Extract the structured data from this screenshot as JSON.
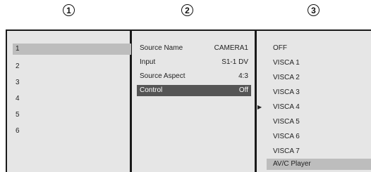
{
  "callouts": [
    "1",
    "2",
    "3"
  ],
  "column1": {
    "items": [
      "1",
      "2",
      "3",
      "4",
      "5",
      "6"
    ],
    "selected_index": 0
  },
  "column2": {
    "rows": [
      {
        "label": "Source Name",
        "value": "CAMERA1"
      },
      {
        "label": "Input",
        "value": "S1-1 DV"
      },
      {
        "label": "Source Aspect",
        "value": "4:3"
      },
      {
        "label": "Control",
        "value": "Off"
      }
    ],
    "highlighted_index": 3
  },
  "column3": {
    "items": [
      "OFF",
      "VISCA 1",
      "VISCA 2",
      "VISCA 3",
      "VISCA 4",
      "VISCA 5",
      "VISCA 6",
      "VISCA 7",
      "AV/C Player"
    ],
    "current_marker_index": 4,
    "current_marker_glyph": "▶",
    "highlighted_index": 8
  },
  "colors": {
    "panel_bg": "#e6e6e6",
    "highlight_dark": "#555555",
    "highlight_light": "#bdbdbd",
    "rule": "#1a1a1a"
  }
}
